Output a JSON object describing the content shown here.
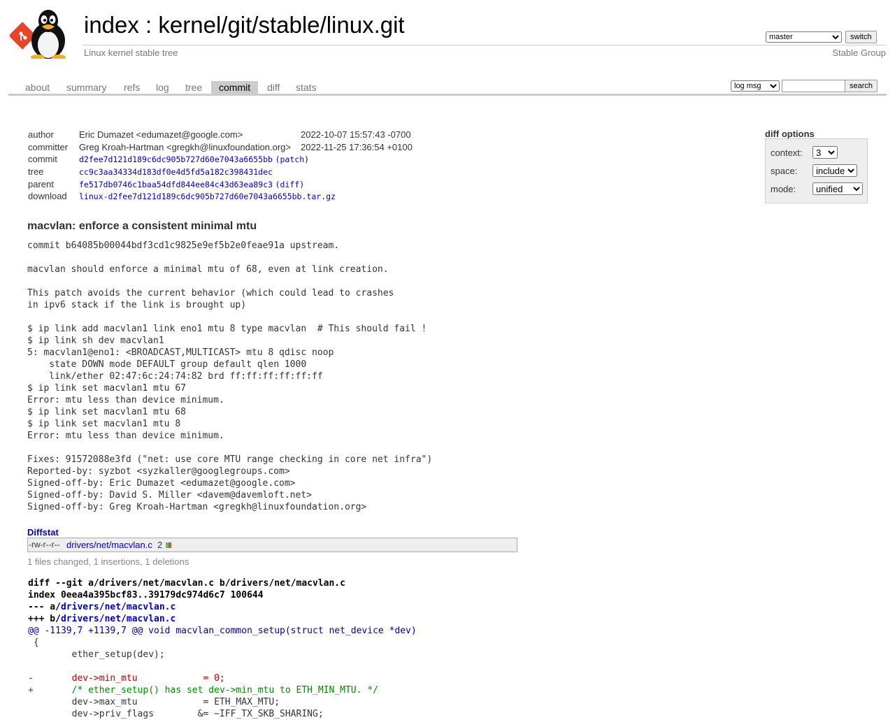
{
  "header": {
    "title": "index : kernel/git/stable/linux.git",
    "subtitle": "Linux kernel stable tree",
    "owner": "Stable Group",
    "branch": "master",
    "switch_label": "switch"
  },
  "tabs": [
    "about",
    "summary",
    "refs",
    "log",
    "tree",
    "commit",
    "diff",
    "stats"
  ],
  "active_tab": "commit",
  "search": {
    "mode": "log msg",
    "value": "",
    "button": "search"
  },
  "commit_info": {
    "author_label": "author",
    "author": "Eric Dumazet <edumazet@google.com>",
    "author_date": "2022-10-07 15:57:43 -0700",
    "committer_label": "committer",
    "committer": "Greg Kroah-Hartman <gregkh@linuxfoundation.org>",
    "committer_date": "2022-11-25 17:36:54 +0100",
    "commit_label": "commit",
    "commit_hash": "d2fee7d121d189c6dc905b727d60e7043a6655bb",
    "commit_extra": "(patch)",
    "tree_label": "tree",
    "tree_hash": "cc9c3aa34334d183df0e4d5fd5a182c398431dec",
    "parent_label": "parent",
    "parent_hash": "fe517db0746c1baa54dfd844ee84c43d63ea89c3",
    "parent_extra": "(diff)",
    "download_label": "download",
    "download_file": "linux-d2fee7d121d189c6dc905b727d60e7043a6655bb.tar.gz"
  },
  "diff_options": {
    "title": "diff options",
    "context_label": "context:",
    "context_value": "3",
    "space_label": "space:",
    "space_value": "include",
    "mode_label": "mode:",
    "mode_value": "unified"
  },
  "subject": "macvlan: enforce a consistent minimal mtu",
  "message": "commit b64085b00044bdf3cd1c9825e9ef5b2e0feae91a upstream.\n\nmacvlan should enforce a minimal mtu of 68, even at link creation.\n\nThis patch avoids the current behavior (which could lead to crashes\nin ipv6 stack if the link is brought up)\n\n$ ip link add macvlan1 link eno1 mtu 8 type macvlan  # This should fail !\n$ ip link sh dev macvlan1\n5: macvlan1@eno1: <BROADCAST,MULTICAST> mtu 8 qdisc noop\n    state DOWN mode DEFAULT group default qlen 1000\n    link/ether 02:47:6c:24:74:82 brd ff:ff:ff:ff:ff:ff\n$ ip link set macvlan1 mtu 67\nError: mtu less than device minimum.\n$ ip link set macvlan1 mtu 68\n$ ip link set macvlan1 mtu 8\nError: mtu less than device minimum.\n\nFixes: 91572088e3fd (\"net: use core MTU range checking in core net infra\")\nReported-by: syzbot <syzkaller@googlegroups.com>\nSigned-off-by: Eric Dumazet <edumazet@google.com>\nSigned-off-by: David S. Miller <davem@davemloft.net>\nSigned-off-by: Greg Kroah-Hartman <gregkh@linuxfoundation.org>",
  "diffstat": {
    "title": "Diffstat",
    "mode": "-rw-r--r--",
    "file": "drivers/net/macvlan.c",
    "count": "2",
    "insertions": 1,
    "deletions": 1,
    "summary": "1 files changed, 1 insertions, 1 deletions"
  },
  "diff": {
    "line1": "diff --git a/drivers/net/macvlan.c b/drivers/net/macvlan.c",
    "line2": "index 0eea4a395bcf83..39179dc974d6c7 100644",
    "minus_prefix": "--- a/",
    "plus_prefix": "+++ b/",
    "file": "drivers/net/macvlan.c",
    "hunk": "@@ -1139,7 +1139,7 @@ void macvlan_common_setup(struct net_device *dev)",
    "ctx1": " {",
    "ctx2": " \tether_setup(dev);",
    "ctx3": " ",
    "del1": "-\tdev->min_mtu\t\t= 0;",
    "add1": "+\t/* ether_setup() has set dev->min_mtu to ETH_MIN_MTU. */",
    "ctx4": " \tdev->max_mtu\t\t= ETH_MAX_MTU;",
    "ctx5": " \tdev->priv_flags\t       &= ~IFF_TX_SKB_SHARING;"
  },
  "colors": {
    "link": "#0000bb",
    "tab_active_bg": "#cccccc",
    "diff_add": "#008800",
    "diff_del": "#aa0000",
    "diff_hunk": "#000099"
  }
}
